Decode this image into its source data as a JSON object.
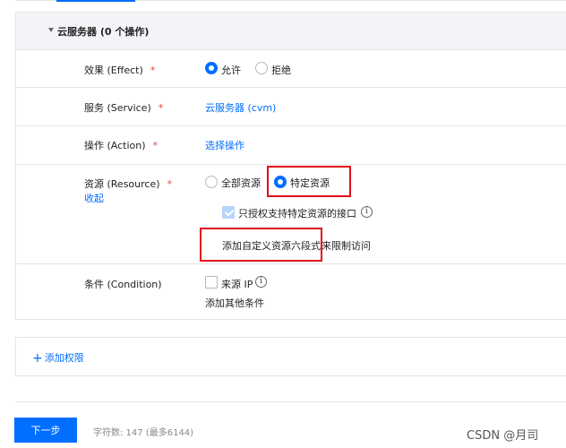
{
  "section": {
    "title": "云服务器 (0 个操作)"
  },
  "effect": {
    "label": "效果 (Effect)",
    "required": "*",
    "options": [
      "允许",
      "拒绝"
    ],
    "selected": "允许"
  },
  "service": {
    "label": "服务 (Service)",
    "required": "*",
    "value": "云服务器 (cvm)"
  },
  "action": {
    "label": "操作 (Action)",
    "required": "*",
    "value": "选择操作"
  },
  "resource": {
    "label": "资源 (Resource)",
    "required": "*",
    "collapse": "收起",
    "options": [
      "全部资源",
      "特定资源"
    ],
    "selected": "特定资源",
    "checkbox_label": "只授权支持特定资源的接口",
    "checkbox_checked": true,
    "add_link": "添加自定义资源六段式",
    "add_suffix": "来限制访问"
  },
  "condition": {
    "label": "条件 (Condition)",
    "checkbox_label": "来源 IP",
    "checkbox_checked": false,
    "add_link": "添加其他条件"
  },
  "add_permission": {
    "plus": "+",
    "label": "添加权限"
  },
  "footer": {
    "next_button": "下一步",
    "char_count": "字符数: 147 (最多6144)"
  },
  "watermark": "CSDN @月司",
  "colors": {
    "accent": "#006eff",
    "required": "#e54545",
    "highlight_box": "#e0101a"
  },
  "icons": {
    "info": "info-circle-icon",
    "caret": "caret-down-icon"
  }
}
